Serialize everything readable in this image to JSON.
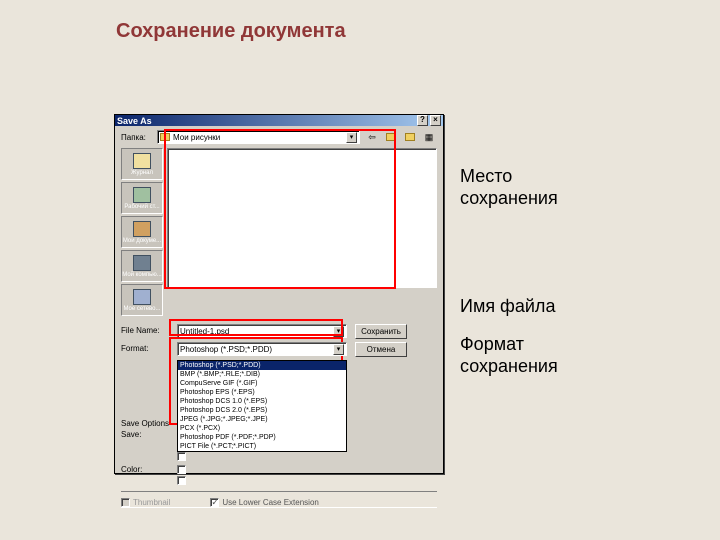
{
  "slide": {
    "title": "Сохранение документа"
  },
  "annotations": {
    "save_location": "Место\nсохранения",
    "file_name": "Имя файла",
    "save_format": "Формат\nсохранения"
  },
  "dialog": {
    "title": "Save As",
    "folder_label": "Папка:",
    "folder_value": "Мои рисунки",
    "places": [
      "Журнал",
      "Рабочий ст...",
      "Мои докуме...",
      "Мой компью...",
      "Мое сетево..."
    ],
    "filename_label": "File Name:",
    "filename_value": "Untitled-1.psd",
    "format_label": "Format:",
    "format_value": "Photoshop (*.PSD;*.PDD)",
    "format_options": [
      "Photoshop (*.PSD;*.PDD)",
      "BMP (*.BMP;*.RLE;*.DIB)",
      "CompuServe GIF (*.GIF)",
      "Photoshop EPS (*.EPS)",
      "Photoshop DCS 1.0 (*.EPS)",
      "Photoshop DCS 2.0 (*.EPS)",
      "JPEG (*.JPG;*.JPEG;*.JPE)",
      "PCX (*.PCX)",
      "Photoshop PDF (*.PDF;*.PDP)",
      "PICT File (*.PCT;*.PICT)"
    ],
    "save_btn": "Сохранить",
    "cancel_btn": "Отмена",
    "save_options_label": "Save Options",
    "save_sub": "Save:",
    "color_sub": "Color:",
    "thumbnail_label": "Thumbnail",
    "lowercase_ext": "Use Lower Case Extension"
  }
}
